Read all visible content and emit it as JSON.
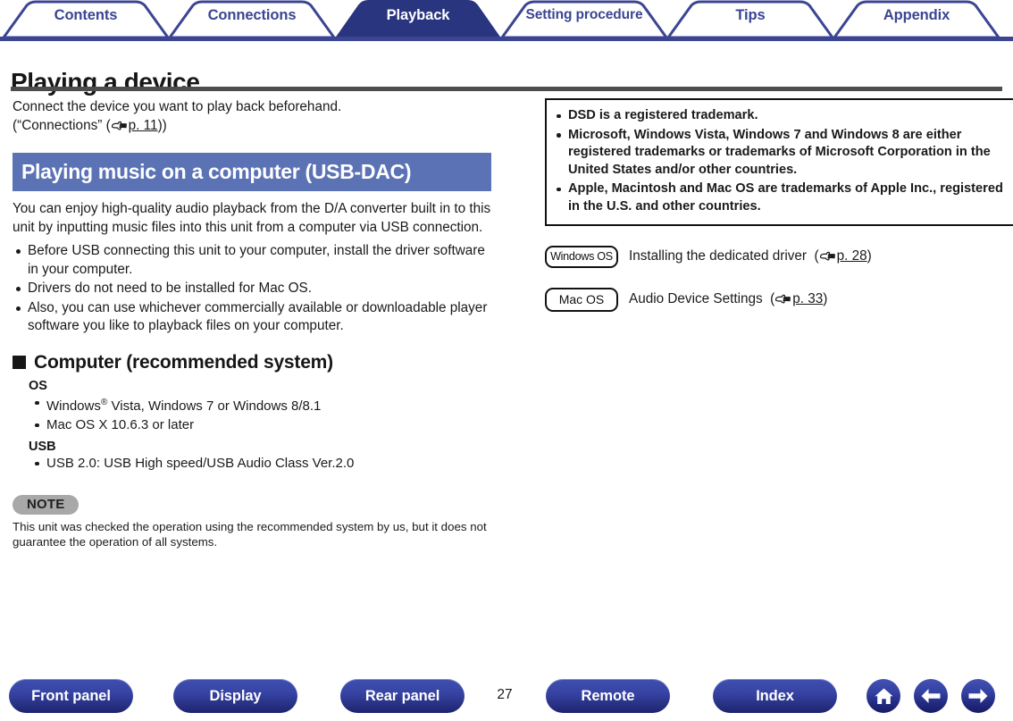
{
  "tabs": [
    {
      "label": "Contents",
      "active": false
    },
    {
      "label": "Connections",
      "active": false
    },
    {
      "label": "Playback",
      "active": true
    },
    {
      "label": "Setting procedure",
      "active": false
    },
    {
      "label": "Tips",
      "active": false
    },
    {
      "label": "Appendix",
      "active": false
    }
  ],
  "page": {
    "title": "Playing a device",
    "number": "27"
  },
  "intro": {
    "line1": "Connect the device you want to play back beforehand.",
    "line2_prefix": "(“Connections” (",
    "link_icon": "pointing-hand-icon",
    "link_page": "p. 11",
    "line2_suffix": "))"
  },
  "section": {
    "heading": "Playing music on a computer (USB-DAC)",
    "paragraph": "You can enjoy high-quality audio playback from the D/A converter built in to this unit by inputting music files into this unit from a computer via USB connection.",
    "bullets": [
      "Before USB connecting this unit to your computer, install the driver software in your computer.",
      "Drivers do not need to be installed for Mac OS.",
      "Also, you can use whichever commercially available or downloadable player software you like to playback files on your computer."
    ]
  },
  "computer": {
    "heading": "Computer (recommended system)",
    "os_label": "OS",
    "os_items": [
      {
        "pre": "Windows",
        "sup": "®",
        "post": " Vista, Windows 7 or Windows 8/8.1"
      },
      {
        "pre": "Mac OS X 10.6.3 or later",
        "sup": "",
        "post": ""
      }
    ],
    "usb_label": "USB",
    "usb_items": [
      "USB 2.0: USB High speed/USB Audio Class Ver.2.0"
    ]
  },
  "note": {
    "badge": "NOTE",
    "text": "This unit was checked the operation using the recommended system by us, but it does not guarantee the operation of all systems."
  },
  "trademarks": {
    "items": [
      "DSD is a registered trademark.",
      "Microsoft, Windows Vista, Windows 7 and Windows 8 are either registered trademarks or trademarks of Microsoft Corporation in the United States and/or other countries.",
      "Apple, Macintosh and Mac OS are trademarks of Apple Inc., registered in the U.S. and other countries."
    ]
  },
  "os_links": [
    {
      "badge": "Windows OS",
      "text": "Installing the dedicated driver",
      "link_page": "p. 28"
    },
    {
      "badge": "Mac OS",
      "text": "Audio Device Settings",
      "link_page": "p. 33"
    }
  ],
  "bottom_nav": {
    "buttons": [
      {
        "label": "Front panel"
      },
      {
        "label": "Display"
      },
      {
        "label": "Rear panel"
      },
      {
        "label": "Remote"
      },
      {
        "label": "Index"
      }
    ],
    "icons": [
      {
        "name": "home-icon"
      },
      {
        "name": "arrow-left-icon"
      },
      {
        "name": "arrow-right-icon"
      }
    ]
  },
  "colors": {
    "tab_navy": "#3b4592",
    "tab_active_fill": "#2a3580",
    "section_blue": "#5b73b5",
    "rule_gray": "#4d4d4d",
    "note_gray": "#a8a8a8",
    "pill_blue": "#2b3588"
  }
}
